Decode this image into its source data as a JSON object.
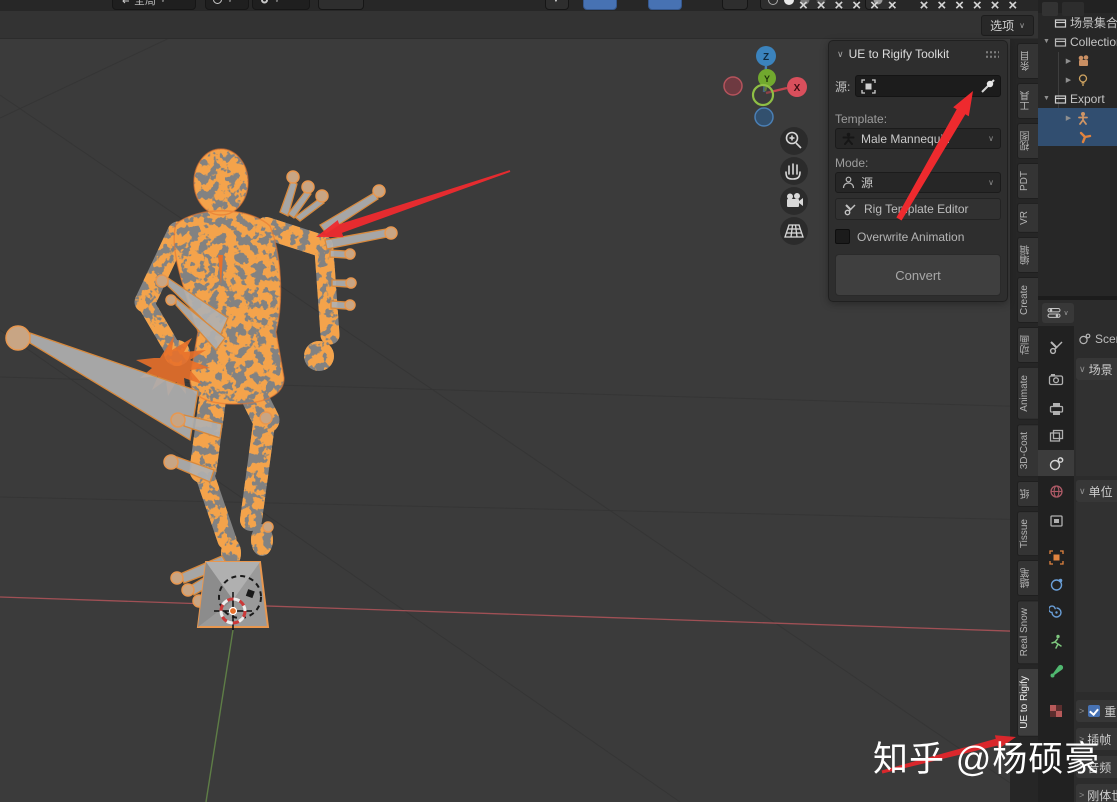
{
  "topbar": {
    "orientation_label": "全局",
    "options_label": "选项",
    "missing_glyphs": [
      "×",
      "×",
      "×",
      "×",
      "×",
      "×",
      "×",
      "×",
      "×",
      "×",
      "×",
      "×"
    ]
  },
  "icons": {
    "chevron_down": "∨",
    "triangle_down": "▼",
    "triangle_right": "▶",
    "collapse_right": ">"
  },
  "viewport": {
    "gizmo": {
      "x_label": "X",
      "y_label": "Y",
      "z_label": "Z"
    }
  },
  "npanel": {
    "title": "UE to Rigify Toolkit",
    "source_label": "源:",
    "template_label": "Template:",
    "template_value": "Male Mannequin",
    "mode_label": "Mode:",
    "mode_value": "源",
    "rig_editor_label": "Rig Template Editor",
    "overwrite_label": "Overwrite Animation",
    "convert_label": "Convert"
  },
  "sidebar_tabs": {
    "tabs": [
      {
        "label": "条目"
      },
      {
        "label": "工具"
      },
      {
        "label": "视图"
      },
      {
        "label": "PDT"
      },
      {
        "label": "VR"
      },
      {
        "label": "编辑"
      },
      {
        "label": "Create"
      },
      {
        "label": "动画"
      },
      {
        "label": "Animate"
      },
      {
        "label": "3D-Coat"
      },
      {
        "label": "纸"
      },
      {
        "label": "Tissue"
      },
      {
        "label": "蜡笔"
      },
      {
        "label": "Real Snow"
      },
      {
        "label": "UE to Rigify"
      }
    ]
  },
  "outliner": {
    "scene_collection_label": "场景集合",
    "collection_label": "Collection",
    "export_label": "Export"
  },
  "properties": {
    "breadcrumb": "Scene",
    "scene_section": "场景",
    "units_section": "单位",
    "gravity_section": "重力",
    "keying_section": "插帧",
    "audio_section": "音频",
    "rigidbody_section": "刚体世界"
  },
  "watermark": {
    "text": "知乎 @杨硕豪"
  },
  "colors": {
    "accent_orange": "#e55f13",
    "selection_blue": "#314e70",
    "arrow_red": "#ee2a2e",
    "axis_x": "#a05055",
    "axis_y": "#5e7d46"
  }
}
